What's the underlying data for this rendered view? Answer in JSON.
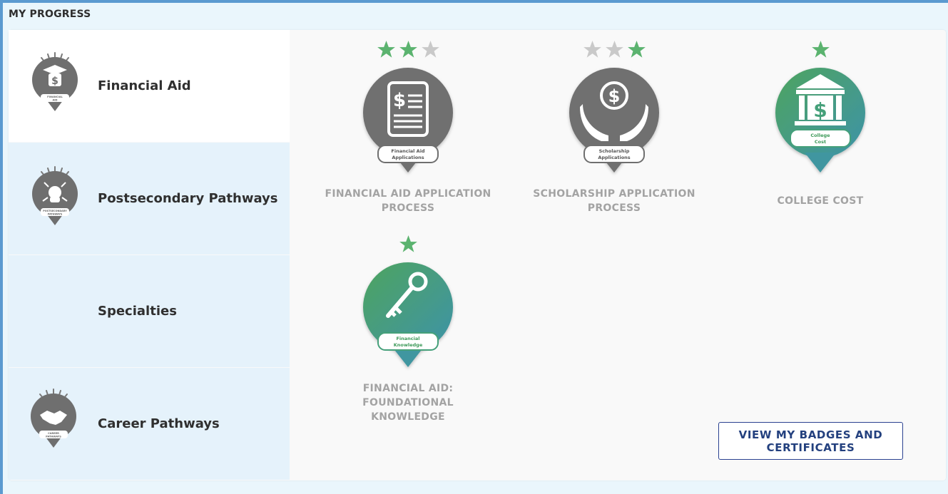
{
  "header": {
    "title": "MY PROGRESS"
  },
  "sidebar": {
    "items": [
      {
        "label": "Financial Aid",
        "icon": "graduate-dollar-icon",
        "icon_caption": "Financial Aid",
        "active": true
      },
      {
        "label": "Postsecondary Pathways",
        "icon": "crossroads-head-icon",
        "icon_caption": "Postsecondary Pathways",
        "active": false
      },
      {
        "label": "Specialties",
        "icon": "",
        "icon_caption": "",
        "active": false
      },
      {
        "label": "Career Pathways",
        "icon": "handshake-icon",
        "icon_caption": "Career Pathways",
        "active": false
      }
    ]
  },
  "badges": [
    {
      "title_line1": "FINANCIAL AID APPLICATION",
      "title_line2": "PROCESS",
      "badge_caption_1": "Financial Aid",
      "badge_caption_2": "Applications",
      "stars_earned": 2,
      "stars_total": 3,
      "earned": false,
      "icon": "document-dollar-icon"
    },
    {
      "title_line1": "SCHOLARSHIP APPLICATION",
      "title_line2": "PROCESS",
      "badge_caption_1": "Scholarship",
      "badge_caption_2": "Applications",
      "stars_earned": 1,
      "stars_total": 3,
      "earned": false,
      "icon": "hands-coin-icon"
    },
    {
      "title_line1": "COLLEGE COST",
      "title_line2": "",
      "badge_caption_1": "College",
      "badge_caption_2": "Cost",
      "stars_earned": 1,
      "stars_total": 1,
      "earned": true,
      "icon": "bank-dollar-icon"
    },
    {
      "title_line1": "FINANCIAL AID: FOUNDATIONAL",
      "title_line2": "KNOWLEDGE",
      "badge_caption_1": "Financial",
      "badge_caption_2": "Knowledge",
      "stars_earned": 1,
      "stars_total": 1,
      "earned": true,
      "icon": "key-icon"
    }
  ],
  "actions": {
    "view_badges_line1": "VIEW MY BADGES AND",
    "view_badges_line2": "CERTIFICATES"
  },
  "colors": {
    "accent_green": "#5bb36f",
    "star_gray": "#c9c9c9",
    "badge_gray": "#6f6f6f",
    "gradient_start": "#4ea45f",
    "gradient_end": "#3e93a8",
    "button_blue": "#23407e"
  }
}
